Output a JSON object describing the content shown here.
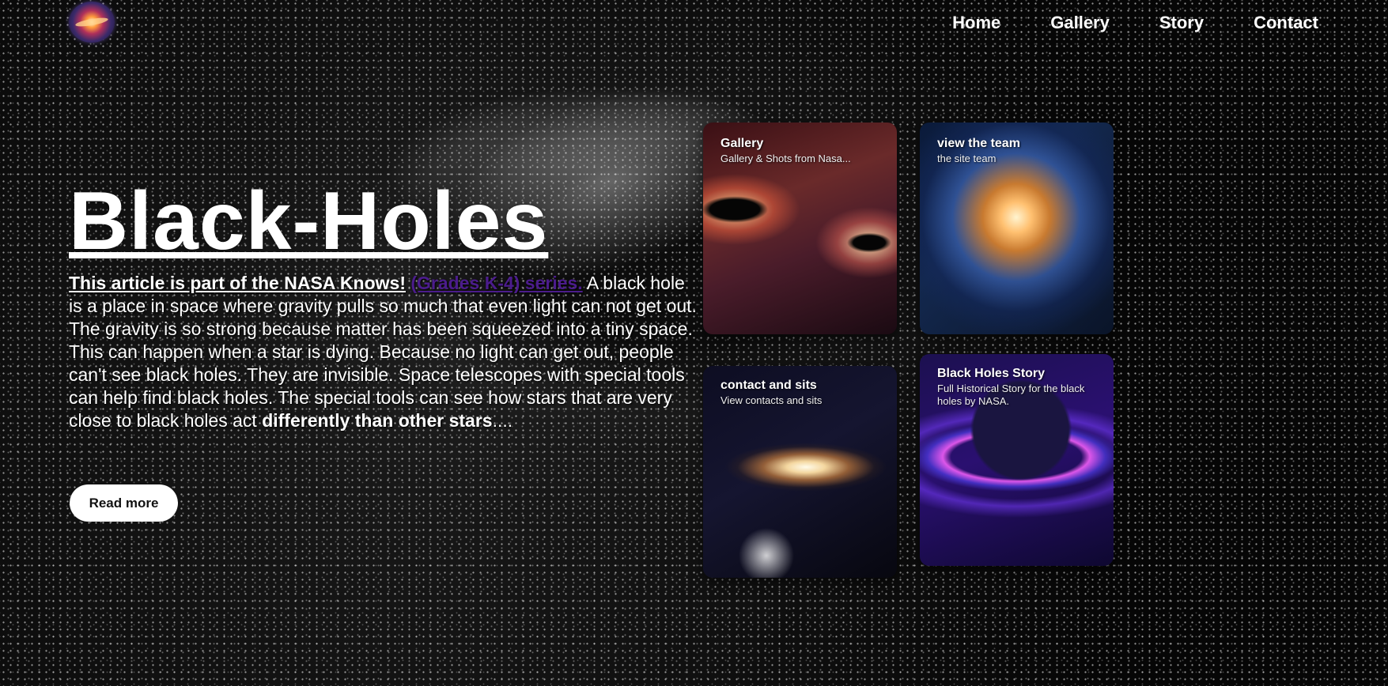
{
  "nav": {
    "items": [
      "Home",
      "Gallery",
      "Story",
      "Contact"
    ]
  },
  "hero": {
    "title": "Black-Holes",
    "intro": "This article is part of the NASA Knows!",
    "series_link": "(Grades K-4) series.",
    "body": " A black hole is a place in space where gravity pulls so much that even light can not get out. The gravity is so strong because matter has been squeezed into a tiny space. This can happen when a star is dying. Because no light can get out, people can't see black holes. They are invisible. Space telescopes with special tools can help find black holes. The special tools can see how stars that are very close to black holes act ",
    "body_strong": "differently than other stars",
    "body_end": "....",
    "read_more": "Read more"
  },
  "cards": [
    {
      "title": "Gallery",
      "subtitle": "Gallery & Shots from Nasa..."
    },
    {
      "title": "view the team",
      "subtitle": "the site team"
    },
    {
      "title": "contact and sits",
      "subtitle": "View contacts and sits"
    },
    {
      "title": "Black Holes Story",
      "subtitle": "Full Historical Story for the black holes by NASA."
    }
  ],
  "icons": {
    "logo": "galaxy-logo"
  }
}
